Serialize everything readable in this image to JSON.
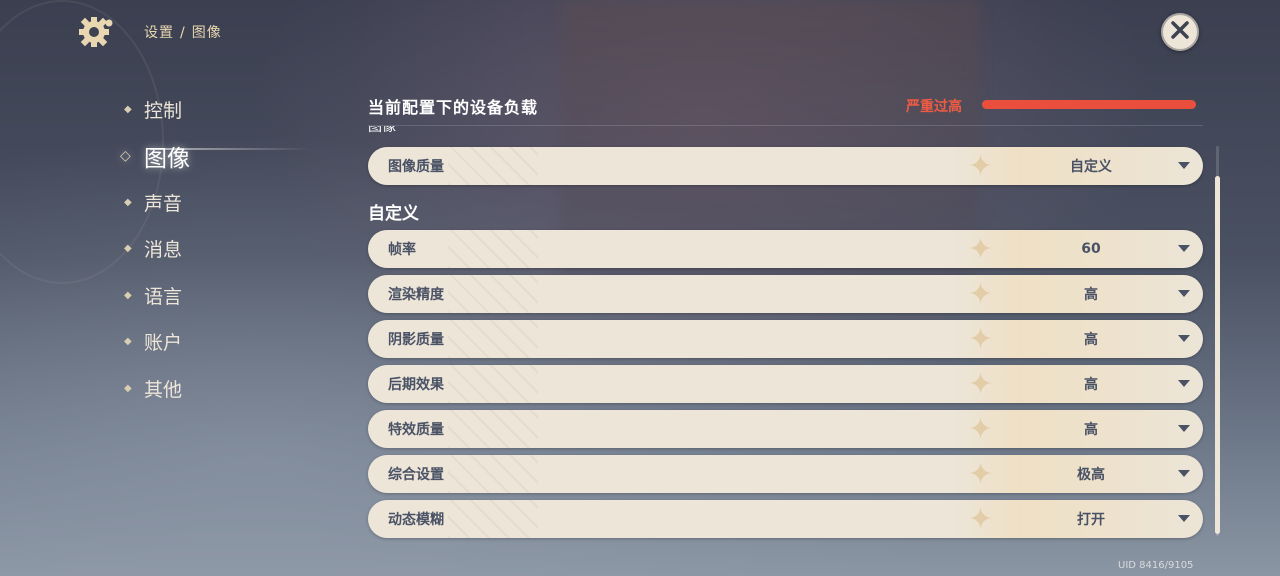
{
  "header": {
    "breadcrumb": {
      "section": "设置",
      "separator": "/",
      "page": "图像"
    },
    "icons": {
      "settings": "gear-icon",
      "close": "close-icon"
    }
  },
  "nav": {
    "items": [
      {
        "label": "控制",
        "active": false
      },
      {
        "label": "图像",
        "active": true
      },
      {
        "label": "声音",
        "active": false
      },
      {
        "label": "消息",
        "active": false
      },
      {
        "label": "语言",
        "active": false
      },
      {
        "label": "账户",
        "active": false
      },
      {
        "label": "其他",
        "active": false
      }
    ]
  },
  "device_load": {
    "title": "当前配置下的设备负载",
    "status": "严重过高",
    "level": 1.0,
    "color": "#ea4f3e"
  },
  "graphics_quality": {
    "section_label_partial": "图像",
    "label": "图像质量",
    "value": "自定义"
  },
  "custom": {
    "title": "自定义",
    "rows": [
      {
        "label": "帧率",
        "value": "60"
      },
      {
        "label": "渲染精度",
        "value": "高"
      },
      {
        "label": "阴影质量",
        "value": "高"
      },
      {
        "label": "后期效果",
        "value": "高"
      },
      {
        "label": "特效质量",
        "value": "高"
      },
      {
        "label": "综合设置",
        "value": "极高"
      },
      {
        "label": "动态模糊",
        "value": "打开"
      }
    ]
  },
  "footer": {
    "uid": "UID 8416/9105"
  },
  "colors": {
    "accent_text": "#e8d7b0",
    "row_bg": "#ece5d8",
    "row_text": "#4a5265",
    "warning": "#ef5b43"
  }
}
